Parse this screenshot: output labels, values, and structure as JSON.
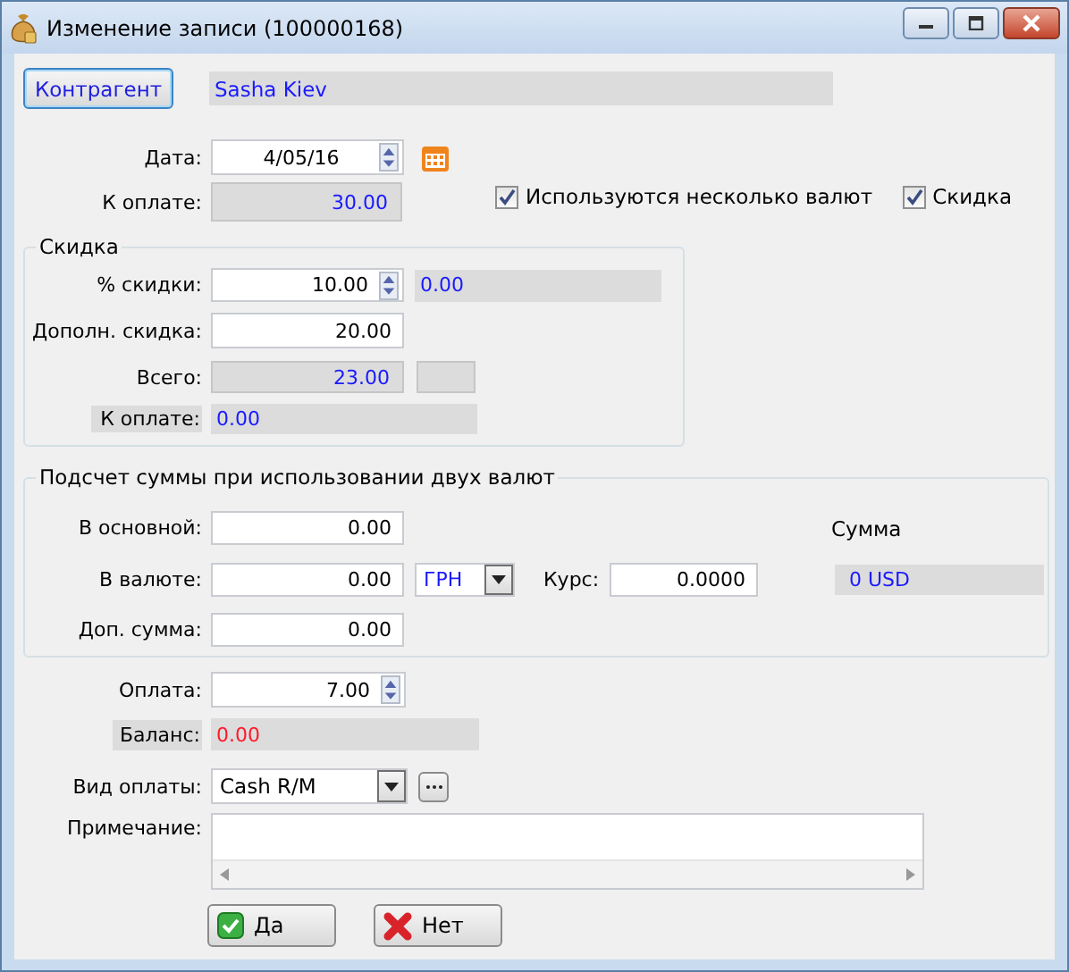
{
  "window": {
    "title": "Изменение записи  (100000168)"
  },
  "counterparty": {
    "button": "Контрагент",
    "value": "Sasha Kiev"
  },
  "date": {
    "label": "Дата:",
    "value": "4/05/16"
  },
  "to_pay": {
    "label": "К оплате:",
    "value": "30.00"
  },
  "options": [
    {
      "label": "Используются несколько валют",
      "checked": true
    },
    {
      "label": "Скидка",
      "checked": true
    }
  ],
  "discount": {
    "title": "Скидка",
    "percent": {
      "label": "% скидки:",
      "value": "10.00",
      "readout": "0.00"
    },
    "extra": {
      "label": "Дополн. скидка:",
      "value": "20.00"
    },
    "total": {
      "label": "Всего:",
      "value": "23.00"
    },
    "to_pay": {
      "label": "К оплате:",
      "value": "0.00"
    }
  },
  "two_currency": {
    "title": "Подсчет суммы при использовании двух валют",
    "base": {
      "label": "В основной:",
      "value": "0.00"
    },
    "currency": {
      "label": "В валюте:",
      "value": "0.00",
      "currency": "ГРН",
      "rate_label": "Курс:",
      "rate": "0.0000"
    },
    "extra": {
      "label": "Доп. сумма:",
      "value": "0.00"
    },
    "sum": {
      "label": "Сумма",
      "value": "0 USD"
    }
  },
  "payment": {
    "label": "Оплата:",
    "value": "7.00"
  },
  "balance": {
    "label": "Баланс:",
    "value": "0.00"
  },
  "payment_type": {
    "label": "Вид оплаты:",
    "value": "Cash R/M"
  },
  "note": {
    "label": "Примечание:"
  },
  "buttons": [
    {
      "label": "Да",
      "kind": "ok"
    },
    {
      "label": "Нет",
      "kind": "cancel"
    }
  ]
}
